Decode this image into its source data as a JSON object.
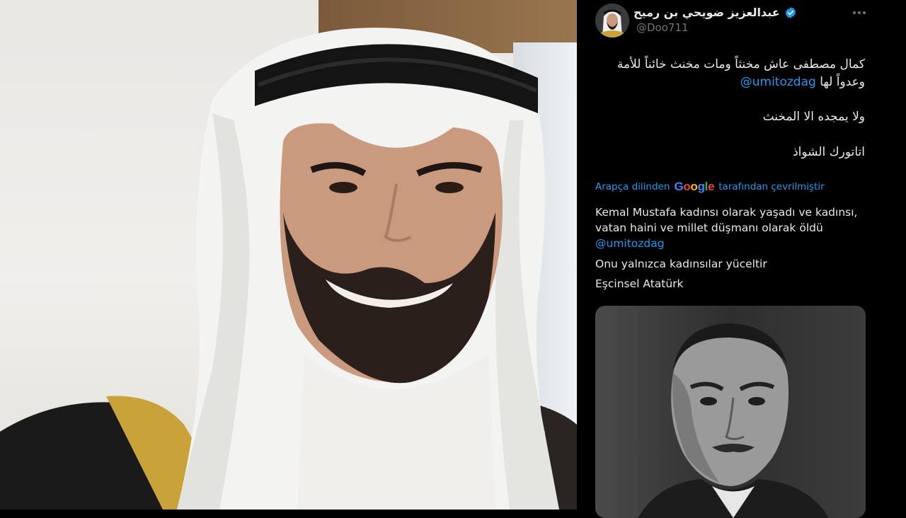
{
  "tweet": {
    "display_name": "عبدالعزيز ضويحي بن رميح",
    "handle": "@Doo711",
    "more_icon": "more-horizontal-icon",
    "verified_icon": "verified-badge-icon",
    "arabic": {
      "line1": "كمال مصطفى عاش مخنثاً ومات مخنث خائناً للأمة",
      "line2_text": "وعدواً لها",
      "line2_mention": "@umitozdag",
      "line3": "ولا يمجده الا المخنث",
      "line4": "اتاتورك الشواذ"
    },
    "translation": {
      "prefix": "Arapça dilinden",
      "google_logo": "Google",
      "suffix": "tarafından çevrilmiştir",
      "line1": "Kemal Mustafa kadınsı olarak yaşadı ve kadınsı,",
      "line2": "vatan haini ve millet düşmanı olarak öldü",
      "mention": "@umitozdag",
      "line3": "Onu yalnızca kadınsılar yüceltir",
      "line4": "Eşcinsel Atatürk"
    }
  },
  "colors": {
    "accent": "#1d9bf0",
    "background": "#000000",
    "text": "#e7e9ea",
    "muted": "#71767b"
  }
}
